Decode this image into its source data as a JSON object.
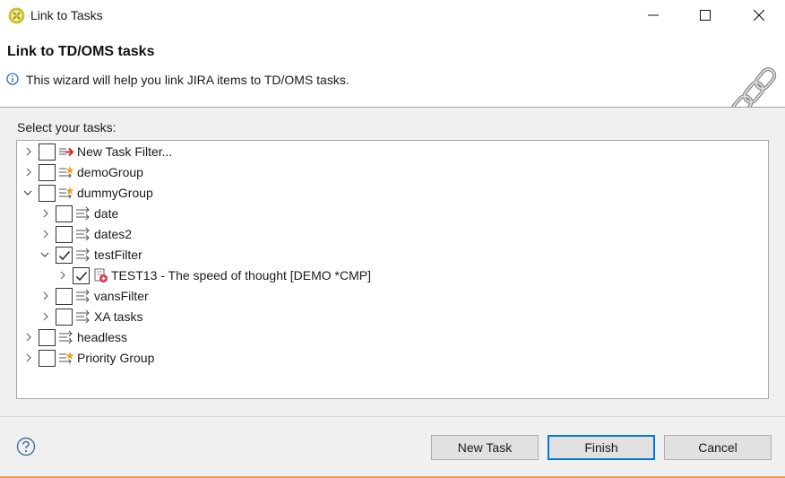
{
  "window": {
    "title": "Link to Tasks"
  },
  "header": {
    "title": "Link to TD/OMS tasks",
    "description": "This wizard will help you link JIRA items to TD/OMS tasks."
  },
  "tasks": {
    "label": "Select your tasks:",
    "tree": [
      {
        "label": "New Task Filter...",
        "icon": "new-filter-icon",
        "expanded": false,
        "checked": false
      },
      {
        "label": "demoGroup",
        "icon": "group-icon",
        "expanded": false,
        "checked": false
      },
      {
        "label": "dummyGroup",
        "icon": "group-icon",
        "expanded": true,
        "checked": false
      },
      {
        "label": "date",
        "icon": "filter-icon",
        "expanded": false,
        "checked": false
      },
      {
        "label": "dates2",
        "icon": "filter-icon",
        "expanded": false,
        "checked": false
      },
      {
        "label": "testFilter",
        "icon": "filter-icon",
        "expanded": true,
        "checked": true
      },
      {
        "label": "TEST13 - The speed of thought [DEMO *CMP]",
        "icon": "task-icon",
        "expanded": false,
        "checked": true
      },
      {
        "label": "vansFilter",
        "icon": "filter-icon",
        "expanded": false,
        "checked": false
      },
      {
        "label": "XA tasks",
        "icon": "filter-icon",
        "expanded": false,
        "checked": false
      },
      {
        "label": "headless",
        "icon": "filter-icon",
        "expanded": false,
        "checked": false
      },
      {
        "label": "Priority Group",
        "icon": "group-icon",
        "expanded": false,
        "checked": false
      }
    ]
  },
  "buttons": {
    "new_task": "New Task",
    "finish": "Finish",
    "cancel": "Cancel"
  },
  "colors": {
    "accent": "#0078d7",
    "bottom_bar": "#e8a24c",
    "body_bg": "#f0f0f0"
  }
}
